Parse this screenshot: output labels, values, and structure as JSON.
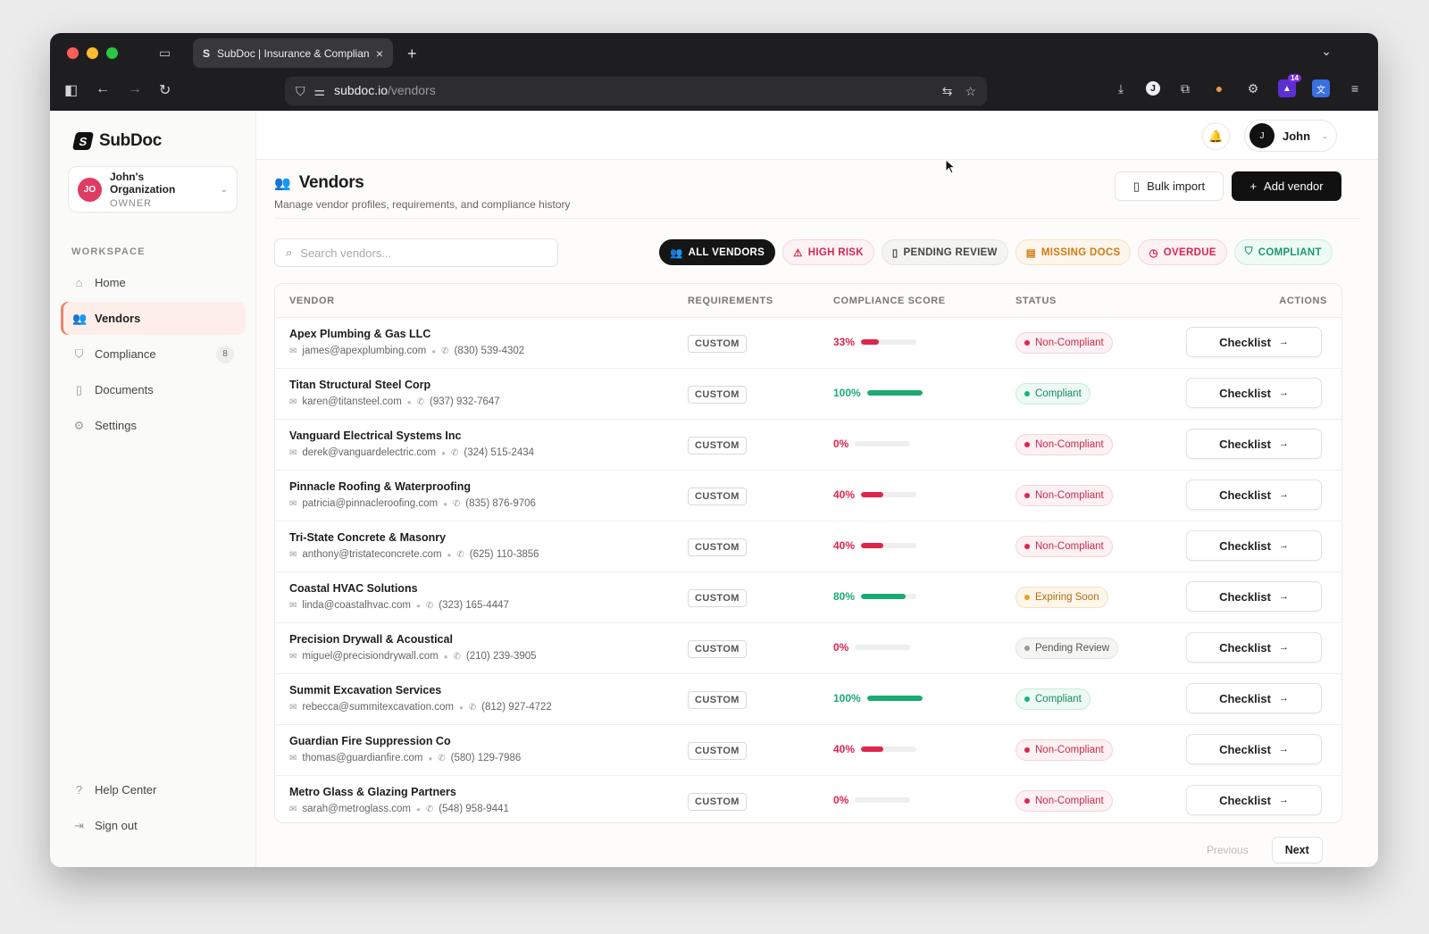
{
  "browser": {
    "tab_title": "SubDoc | Insurance & Compliance",
    "url_host": "subdoc.io",
    "url_path": "/vendors",
    "ext_badge": "14"
  },
  "sidebar": {
    "brand": "SubDoc",
    "org": {
      "initials": "JO",
      "name": "John's Organization",
      "role": "OWNER"
    },
    "section_label": "WORKSPACE",
    "items": [
      {
        "label": "Home",
        "icon": "home-icon"
      },
      {
        "label": "Vendors",
        "icon": "users-icon",
        "active": true
      },
      {
        "label": "Compliance",
        "icon": "shield-icon",
        "count": "8"
      },
      {
        "label": "Documents",
        "icon": "document-icon"
      },
      {
        "label": "Settings",
        "icon": "gear-icon"
      }
    ],
    "bottom": [
      {
        "label": "Help Center",
        "icon": "help-icon"
      },
      {
        "label": "Sign out",
        "icon": "signout-icon"
      }
    ]
  },
  "topbar": {
    "user_initial": "J",
    "user_name": "John"
  },
  "page": {
    "title": "Vendors",
    "subtitle": "Manage vendor profiles, requirements, and compliance history",
    "bulk_import": "Bulk import",
    "add_vendor": "Add vendor",
    "search_placeholder": "Search vendors..."
  },
  "filters": [
    {
      "label": "ALL VENDORS",
      "color": "#ffffff",
      "bg": "#151515",
      "border": "#151515",
      "icon": "users-icon",
      "glyph": "👥"
    },
    {
      "label": "HIGH RISK",
      "color": "#d6274f",
      "bg": "#fdf2f4",
      "border": "#f6d6dd",
      "icon": "warning-icon",
      "glyph": "⚠"
    },
    {
      "label": "PENDING REVIEW",
      "color": "#444444",
      "bg": "#f4f4f2",
      "border": "#e5e5e2",
      "icon": "document-icon",
      "glyph": "▯"
    },
    {
      "label": "MISSING DOCS",
      "color": "#d07a12",
      "bg": "#fdf6ec",
      "border": "#f5e2c6",
      "icon": "document-icon",
      "glyph": "▤"
    },
    {
      "label": "OVERDUE",
      "color": "#d6274f",
      "bg": "#fdf2f4",
      "border": "#f6d6dd",
      "icon": "clock-icon",
      "glyph": "◷"
    },
    {
      "label": "COMPLIANT",
      "color": "#1a9a6a",
      "bg": "#eefaf4",
      "border": "#cdeedd",
      "icon": "shield-check-icon",
      "glyph": "⛉"
    }
  ],
  "table": {
    "headers": {
      "vendor": "VENDOR",
      "requirements": "REQUIREMENTS",
      "score": "COMPLIANCE SCORE",
      "status": "STATUS",
      "actions": "ACTIONS"
    },
    "rows": [
      {
        "name": "Apex Plumbing & Gas LLC",
        "email": "james@apexplumbing.com",
        "phone": "(830) 539-4302",
        "req": "CUSTOM",
        "score": "33%",
        "score_value": 33,
        "status": "Non-Compliant",
        "action": "Checklist"
      },
      {
        "name": "Titan Structural Steel Corp",
        "email": "karen@titansteel.com",
        "phone": "(937) 932-7647",
        "req": "CUSTOM",
        "score": "100%",
        "score_value": 100,
        "status": "Compliant",
        "action": "Checklist"
      },
      {
        "name": "Vanguard Electrical Systems Inc",
        "email": "derek@vanguardelectric.com",
        "phone": "(324) 515-2434",
        "req": "CUSTOM",
        "score": "0%",
        "score_value": 0,
        "status": "Non-Compliant",
        "action": "Checklist"
      },
      {
        "name": "Pinnacle Roofing & Waterproofing",
        "email": "patricia@pinnacleroofing.com",
        "phone": "(835) 876-9706",
        "req": "CUSTOM",
        "score": "40%",
        "score_value": 40,
        "status": "Non-Compliant",
        "action": "Checklist"
      },
      {
        "name": "Tri-State Concrete & Masonry",
        "email": "anthony@tristateconcrete.com",
        "phone": "(625) 110-3856",
        "req": "CUSTOM",
        "score": "40%",
        "score_value": 40,
        "status": "Non-Compliant",
        "action": "Checklist"
      },
      {
        "name": "Coastal HVAC Solutions",
        "email": "linda@coastalhvac.com",
        "phone": "(323) 165-4447",
        "req": "CUSTOM",
        "score": "80%",
        "score_value": 80,
        "status": "Expiring Soon",
        "action": "Checklist"
      },
      {
        "name": "Precision Drywall & Acoustical",
        "email": "miguel@precisiondrywall.com",
        "phone": "(210) 239-3905",
        "req": "CUSTOM",
        "score": "0%",
        "score_value": 0,
        "status": "Pending Review",
        "action": "Checklist"
      },
      {
        "name": "Summit Excavation Services",
        "email": "rebecca@summitexcavation.com",
        "phone": "(812) 927-4722",
        "req": "CUSTOM",
        "score": "100%",
        "score_value": 100,
        "status": "Compliant",
        "action": "Checklist"
      },
      {
        "name": "Guardian Fire Suppression Co",
        "email": "thomas@guardianfire.com",
        "phone": "(580) 129-7986",
        "req": "CUSTOM",
        "score": "40%",
        "score_value": 40,
        "status": "Non-Compliant",
        "action": "Checklist"
      },
      {
        "name": "Metro Glass & Glazing Partners",
        "email": "sarah@metroglass.com",
        "phone": "(548) 958-9441",
        "req": "CUSTOM",
        "score": "0%",
        "score_value": 0,
        "status": "Non-Compliant",
        "action": "Checklist"
      }
    ]
  },
  "status_colors": {
    "Non-Compliant": {
      "text": "#c92a4a",
      "bg": "#fdf1f3",
      "border": "#f5d3da",
      "dot": "#e0254d"
    },
    "Compliant": {
      "text": "#178a5e",
      "bg": "#edf9f3",
      "border": "#c7ecd9",
      "dot": "#1ab377"
    },
    "Expiring Soon": {
      "text": "#b56a0e",
      "bg": "#fdf6ea",
      "border": "#f4e0bf",
      "dot": "#f0a020"
    },
    "Pending Review": {
      "text": "#555555",
      "bg": "#f5f5f4",
      "border": "#e3e3e1",
      "dot": "#9a9a9a"
    }
  },
  "score_colors": {
    "low": "#e0254d",
    "high": "#1aaa72"
  },
  "pagination": {
    "previous": "Previous",
    "next": "Next"
  }
}
